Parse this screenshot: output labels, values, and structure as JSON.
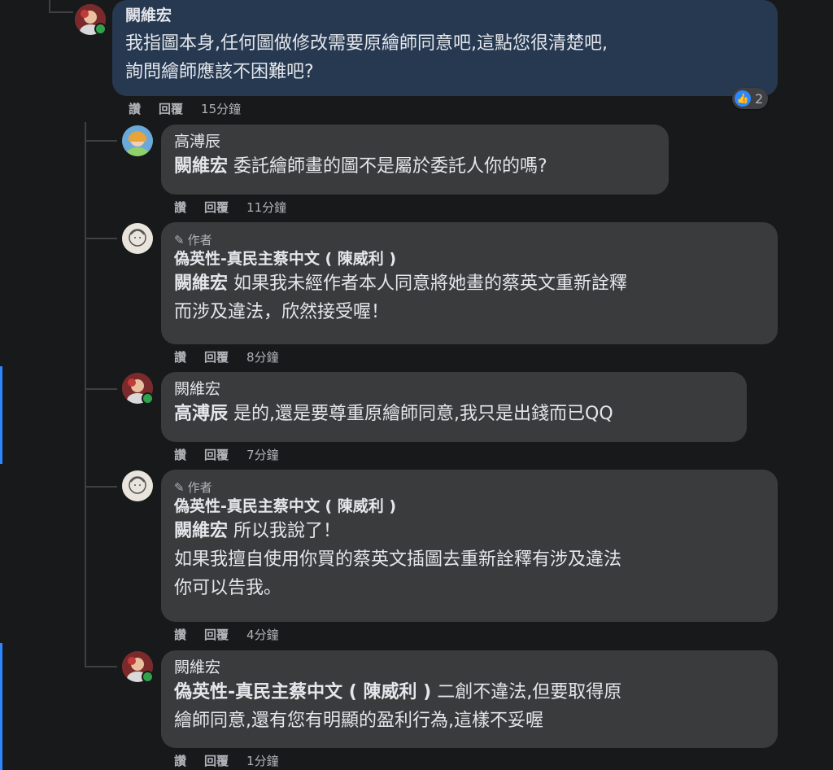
{
  "comments": [
    {
      "name": "闕維宏",
      "mention": "",
      "lines": [
        "我指圖本身,任何圖做修改需要原繪師同意吧,這點您很清楚吧,",
        "詢問繪師應該不困難吧?"
      ],
      "actions": {
        "like": "讚",
        "reply": "回覆",
        "time": "15分鐘"
      },
      "reaction_count": "2",
      "reaction_icon": "thumbs-up-icon"
    },
    {
      "name": "高溥辰",
      "mention": "闕維宏",
      "lines": [
        "委託繪師畫的圖不是屬於委託人你的嗎?"
      ],
      "actions": {
        "like": "讚",
        "reply": "回覆",
        "time": "11分鐘"
      }
    },
    {
      "author_badge": "作者",
      "name": "偽英性-真民主蔡中文 ( 陳威利 )",
      "mention": "闕維宏",
      "lines": [
        "如果我未經作者本人同意將她畫的蔡英文重新詮釋",
        "而涉及違法，欣然接受喔！"
      ],
      "actions": {
        "like": "讚",
        "reply": "回覆",
        "time": "8分鐘"
      }
    },
    {
      "name": "闕維宏",
      "mention": "高溥辰",
      "lines": [
        "是的,還是要尊重原繪師同意,我只是出錢而已QQ"
      ],
      "actions": {
        "like": "讚",
        "reply": "回覆",
        "time": "7分鐘"
      }
    },
    {
      "author_badge": "作者",
      "name": "偽英性-真民主蔡中文 ( 陳威利 )",
      "mention": "闕維宏",
      "lines": [
        "所以我說了！",
        "如果我擅自使用你買的蔡英文插圖去重新詮釋有涉及違法",
        "你可以告我。"
      ],
      "actions": {
        "like": "讚",
        "reply": "回覆",
        "time": "4分鐘"
      }
    },
    {
      "name": "闕維宏",
      "mention": "偽英性-真民主蔡中文 ( 陳威利 )",
      "lines": [
        "二創不違法,但要取得原",
        "繪師同意,還有您有明顯的盈利行為,這樣不妥喔"
      ],
      "actions": {
        "like": "讚",
        "reply": "回覆",
        "time": "1分鐘"
      }
    }
  ],
  "colors": {
    "background": "#18191a",
    "bubble": "#3a3b3c",
    "highlighted_bubble": "#263951",
    "accent": "#2d88ff",
    "online": "#31a24c"
  },
  "icons": {
    "author": "pencil-icon",
    "reaction": "thumbs-up-icon"
  }
}
